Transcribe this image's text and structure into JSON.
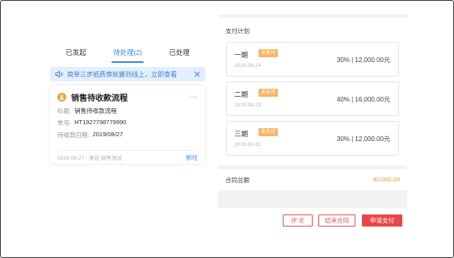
{
  "tabs": [
    {
      "label": "已发起"
    },
    {
      "label": "待处理(2)"
    },
    {
      "label": "已处理"
    }
  ],
  "notice": {
    "text": "简单三步纸质审批搬到线上，立即查看",
    "icon": "speaker-icon"
  },
  "card": {
    "title": "销售待收款流程",
    "more": "···",
    "fields": [
      {
        "label": "标题:",
        "value": "销售待收款流程"
      },
      {
        "label": "单号:",
        "value": "HT1927798779990"
      },
      {
        "label": "待收款日期:",
        "value": "2019/08/27"
      }
    ],
    "meta": "2019-08-27 · 来自 财务测试",
    "action": "前往"
  },
  "plan": {
    "title": "支付计划",
    "items": [
      {
        "name": "一期",
        "badge": "未支付",
        "date": "2019-08-14",
        "amount": "30% | 12,000.00元"
      },
      {
        "name": "二期",
        "badge": "未支付",
        "date": "2019-08-23",
        "amount": "40% | 16,000.00元"
      },
      {
        "name": "三期",
        "badge": "未支付",
        "date": "2019-08-31",
        "amount": "30% | 12,000.00元"
      }
    ]
  },
  "total": {
    "label": "合同总额",
    "value": "40,000.00"
  },
  "buttons": {
    "comment": "评 论",
    "end": "结束合同",
    "apply": "申请支付"
  },
  "colors": {
    "accent": "#3d8be0",
    "danger": "#e64848",
    "badge": "#f6b764",
    "amount": "#f39a3b"
  }
}
